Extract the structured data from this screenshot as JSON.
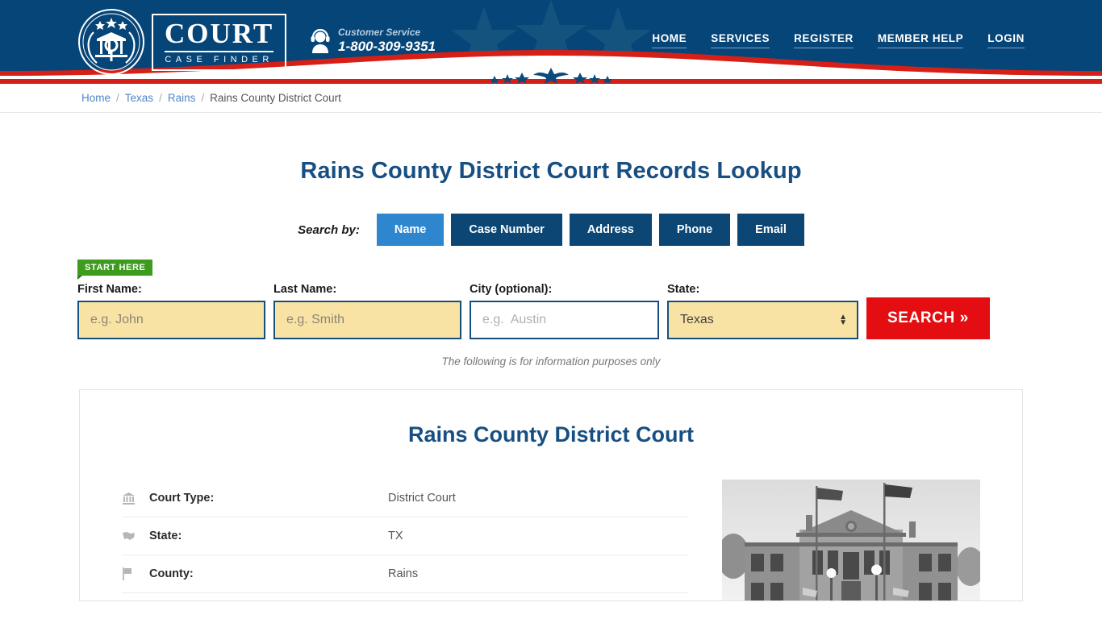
{
  "header": {
    "logo": {
      "title": "COURT",
      "subtitle": "CASE FINDER",
      "seal_icon": "court-seal-icon"
    },
    "customer_service": {
      "label": "Customer Service",
      "phone": "1-800-309-9351",
      "icon": "headset-agent-icon"
    },
    "nav": [
      {
        "label": "HOME"
      },
      {
        "label": "SERVICES"
      },
      {
        "label": "REGISTER"
      },
      {
        "label": "MEMBER HELP"
      },
      {
        "label": "LOGIN"
      }
    ],
    "colors": {
      "navy": "#064578",
      "red": "#d61f16",
      "star": "#1b5b8f"
    }
  },
  "breadcrumb": {
    "items": [
      {
        "label": "Home",
        "link": true
      },
      {
        "label": "Texas",
        "link": true
      },
      {
        "label": "Rains",
        "link": true
      },
      {
        "label": "Rains County District Court",
        "link": false
      }
    ],
    "separator": "/"
  },
  "main": {
    "page_title": "Rains County District Court Records Lookup",
    "search_by_label": "Search by:",
    "tabs": [
      {
        "label": "Name",
        "active": true
      },
      {
        "label": "Case Number",
        "active": false
      },
      {
        "label": "Address",
        "active": false
      },
      {
        "label": "Phone",
        "active": false
      },
      {
        "label": "Email",
        "active": false
      }
    ],
    "start_badge": "START HERE",
    "form": {
      "first_name": {
        "label": "First Name:",
        "placeholder": "e.g. John",
        "value": ""
      },
      "last_name": {
        "label": "Last Name:",
        "placeholder": "e.g. Smith",
        "value": ""
      },
      "city": {
        "label": "City (optional):",
        "placeholder": "e.g.  Austin",
        "value": ""
      },
      "state": {
        "label": "State:",
        "value": "Texas"
      },
      "search_button": "SEARCH »"
    },
    "disclaimer": "The following is for information purposes only"
  },
  "card": {
    "heading": "Rains County District Court",
    "details": [
      {
        "icon": "bank-columns-icon",
        "key": "Court Type:",
        "value": "District Court"
      },
      {
        "icon": "us-map-icon",
        "key": "State:",
        "value": "TX"
      },
      {
        "icon": "flag-icon",
        "key": "County:",
        "value": "Rains"
      }
    ],
    "photo": {
      "icon": "courthouse-photo",
      "alt": "Rains County courthouse black and white photo"
    }
  },
  "colors": {
    "brand_navy": "#064578",
    "title_blue": "#174f82",
    "accent_blue": "#2e86ce",
    "search_red": "#e40d12",
    "badge_green": "#3d9b1e",
    "field_yellow": "#f8e2a4"
  }
}
